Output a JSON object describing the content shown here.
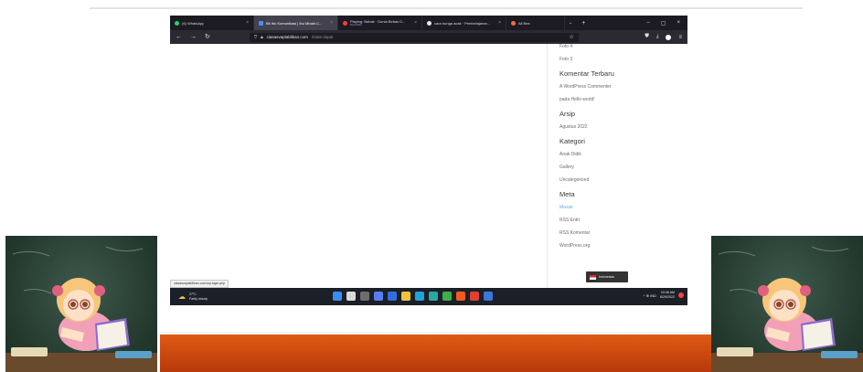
{
  "tabs": [
    {
      "title": "(6) WhatsApp",
      "icon": "whatsapp-icon",
      "active": false
    },
    {
      "title": "Bit Ibu Komunikasi | Ibu Mbabi.C...",
      "icon": "site-icon",
      "active": true
    },
    {
      "title": "Playing: Bahak · Dunia Bebas D...",
      "sub": "PLAYING",
      "icon": "record-icon",
      "active": false
    },
    {
      "title": "cara bunga acak · Pembelajaran...",
      "icon": "google-icon",
      "active": false
    },
    {
      "title": "All files",
      "icon": "files-icon",
      "active": false
    }
  ],
  "address_bar": {
    "host": "ciasasvaptablikan.com",
    "path": "/tidak-dapat"
  },
  "sidebar": {
    "recent_posts": [
      "Foto 4",
      "Foto 3"
    ],
    "recent_comments_heading": "Komentar Terbaru",
    "recent_comments": [
      "A WordPress Commenter",
      "pada Hello world!"
    ],
    "archives_heading": "Arsip",
    "archives": [
      "Agustus 2022"
    ],
    "categories_heading": "Kategori",
    "categories": [
      "Anak Didik",
      "Gallery",
      "Uncategorized"
    ],
    "meta_heading": "Meta",
    "meta": [
      "Masuk",
      "RSS Entri",
      "RSS Komentar",
      "WordPress.org"
    ]
  },
  "status_url": "ciasasvaptablikan.com/wp-login.php",
  "language_popup": "Indonesian",
  "taskbar": {
    "weather_temp": "27°C",
    "weather_desc": "Partly cloudy",
    "tray_text": "^ ⊕ IND",
    "clock_time": "10:46 AM",
    "clock_date": "8/29/2022"
  },
  "colors": {
    "accent": "#6ca9d8",
    "band": "#d2480f",
    "chalkboard": "#2f4a3c"
  }
}
